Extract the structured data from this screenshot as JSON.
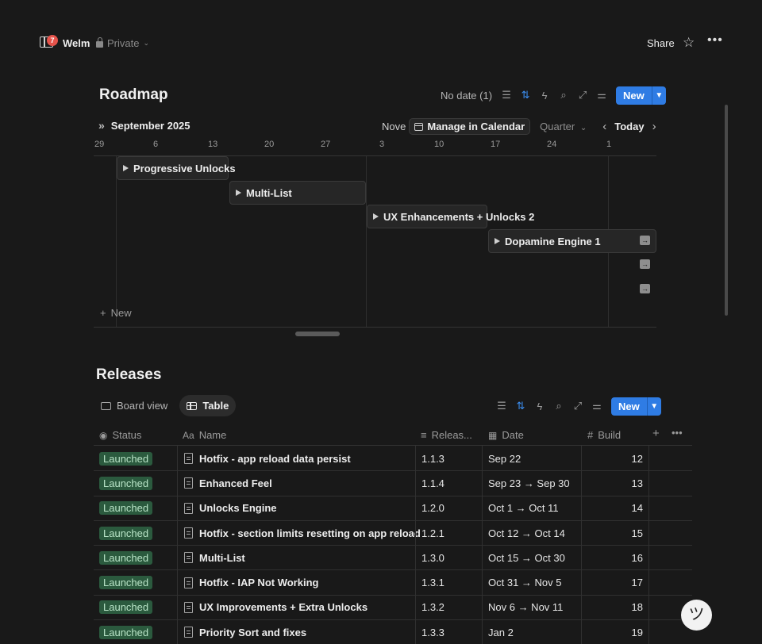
{
  "topbar": {
    "badge_count": "7",
    "workspace": "Welm",
    "privacy": "Private",
    "share": "Share"
  },
  "roadmap": {
    "title": "Roadmap",
    "no_date": "No date (1)",
    "new_label": "New",
    "month": "September 2025",
    "cut_text": "Nove",
    "calendar_button": "Manage in Calendar",
    "range_select": "Quarter",
    "today": "Today",
    "scale": [
      "29",
      "6",
      "13",
      "20",
      "27",
      "3",
      "10",
      "17",
      "24",
      "1"
    ],
    "items": [
      {
        "label": "Progressive Unlocks"
      },
      {
        "label": "Multi-List"
      },
      {
        "label": "UX Enhancements + Unlocks 2"
      },
      {
        "label": "Dopamine Engine 1"
      }
    ],
    "add_new": "New"
  },
  "releases": {
    "title": "Releases",
    "views": [
      {
        "label": "Board view"
      },
      {
        "label": "Table"
      }
    ],
    "new_label": "New",
    "columns": {
      "status": "Status",
      "name": "Name",
      "release": "Releas...",
      "date": "Date",
      "build": "Build"
    },
    "rows": [
      {
        "status": "Launched",
        "name": "Hotfix - app reload data persist",
        "release": "1.1.3",
        "date": "Sep 22",
        "build": "12"
      },
      {
        "status": "Launched",
        "name": "Enhanced Feel",
        "release": "1.1.4",
        "date": "Sep 23 → Sep 30",
        "build": "13"
      },
      {
        "status": "Launched",
        "name": "Unlocks Engine",
        "release": "1.2.0",
        "date": "Oct 1 → Oct 11",
        "build": "14"
      },
      {
        "status": "Launched",
        "name": "Hotfix - section limits resetting on app reload",
        "release": "1.2.1",
        "date": "Oct 12 → Oct 14",
        "build": "15"
      },
      {
        "status": "Launched",
        "name": "Multi-List",
        "release": "1.3.0",
        "date": "Oct 15 → Oct 30",
        "build": "16"
      },
      {
        "status": "Launched",
        "name": "Hotfix - IAP Not Working",
        "release": "1.3.1",
        "date": "Oct 31 → Nov 5",
        "build": "17"
      },
      {
        "status": "Launched",
        "name": "UX Improvements + Extra Unlocks",
        "release": "1.3.2",
        "date": "Nov 6 → Nov 11",
        "build": "18"
      },
      {
        "status": "Launched",
        "name": "Priority Sort and fixes",
        "release": "1.3.3",
        "date": "Jan 2",
        "build": "19"
      }
    ]
  },
  "colors": {
    "accent": "#2f7ce4",
    "launched_bg": "#2b5a3e",
    "badge": "#e5534b"
  }
}
